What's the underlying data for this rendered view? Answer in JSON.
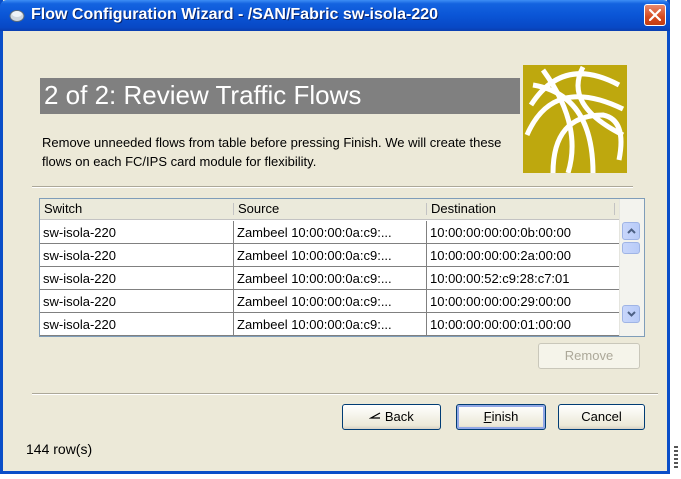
{
  "window": {
    "title": "Flow Configuration Wizard - /SAN/Fabric sw-isola-220"
  },
  "header": {
    "title": "2 of 2: Review Traffic Flows"
  },
  "description": "Remove unneeded flows from table before pressing Finish.  We will create these flows on each FC/IPS card module for flexibility.",
  "table": {
    "columns": [
      "Switch",
      "Source",
      "Destination"
    ],
    "rows": [
      {
        "switch": "sw-isola-220",
        "source": "Zambeel 10:00:00:0a:c9:...",
        "destination": "10:00:00:00:00:0b:00:00"
      },
      {
        "switch": "sw-isola-220",
        "source": "Zambeel 10:00:00:0a:c9:...",
        "destination": "10:00:00:00:00:2a:00:00"
      },
      {
        "switch": "sw-isola-220",
        "source": "Zambeel 10:00:00:0a:c9:...",
        "destination": "10:00:00:52:c9:28:c7:01"
      },
      {
        "switch": "sw-isola-220",
        "source": "Zambeel 10:00:00:0a:c9:...",
        "destination": "10:00:00:00:00:29:00:00"
      },
      {
        "switch": "sw-isola-220",
        "source": "Zambeel 10:00:00:0a:c9:...",
        "destination": "10:00:00:00:00:01:00:00"
      }
    ]
  },
  "buttons": {
    "remove": "Remove",
    "back": "Back",
    "finish_first": "F",
    "finish_rest": "inish",
    "cancel": "Cancel"
  },
  "status": {
    "row_count": "144 row(s)"
  },
  "colors": {
    "titlebar": "#0a55d6",
    "header_bar": "#808080",
    "logo_bg": "#bea80e",
    "close_button": "#d54a1f"
  },
  "icons": [
    "app-icon",
    "close-icon",
    "scroll-up-icon",
    "scroll-down-icon",
    "back-arrow-icon",
    "cisco-logo"
  ]
}
